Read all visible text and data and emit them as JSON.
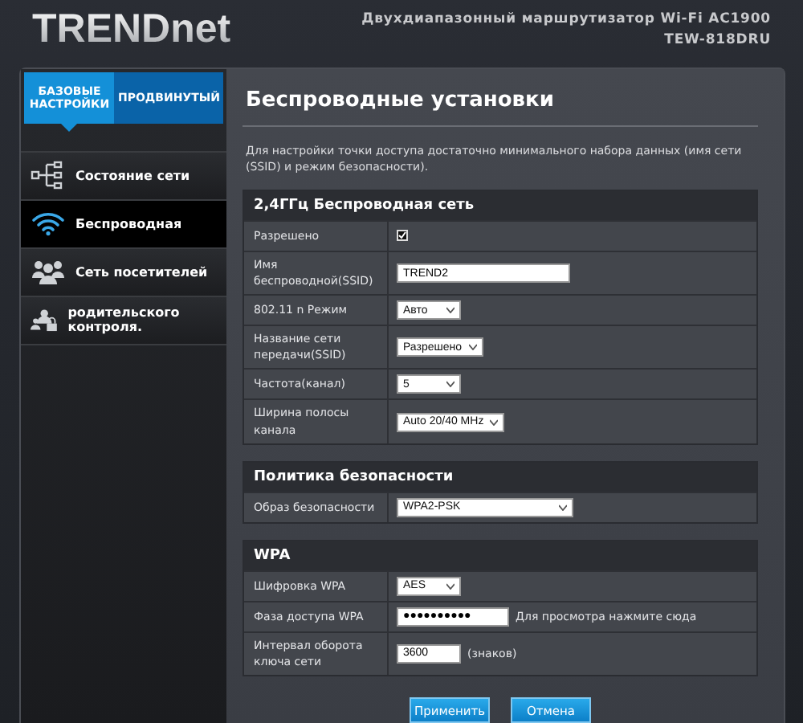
{
  "header": {
    "logo": "TRENDnet",
    "product": "Двухдиапазонный маршрутизатор Wi-Fi AC1900",
    "model": "TEW-818DRU"
  },
  "tabs": [
    {
      "label": "БАЗОВЫЕ НАСТРОЙКИ",
      "selected": true
    },
    {
      "label": "ПРОДВИНУТЫЙ",
      "selected": false
    }
  ],
  "sidebar": {
    "items": [
      {
        "label": "Состояние сети",
        "selected": false
      },
      {
        "label": "Беспроводная",
        "selected": true
      },
      {
        "label": "Сеть посетителей",
        "selected": false
      },
      {
        "label": "родительского контроля.",
        "selected": false
      }
    ]
  },
  "page": {
    "title": "Беспроводные установки",
    "description": "Для настройки точки доступа достаточно минимального набора данных (имя сети (SSID) и режим безопасности)."
  },
  "sections": [
    {
      "title": "2,4ГГц Беспроводная сеть",
      "rows": [
        {
          "label": "Разрешено",
          "kind": "checkbox",
          "checked": true
        },
        {
          "label": "Имя беспроводной(SSID)",
          "kind": "text",
          "value": "TREND2"
        },
        {
          "label": "802.11 n Режим",
          "kind": "select",
          "value": "Авто"
        },
        {
          "label": "Название сети передачи(SSID)",
          "kind": "select",
          "value": "Разрешено"
        },
        {
          "label": "Частота(канал)",
          "kind": "select",
          "value": "5"
        },
        {
          "label": "Ширина полосы канала",
          "kind": "select",
          "value": "Auto 20/40 MHz"
        }
      ]
    },
    {
      "title": "Политика безопасности",
      "rows": [
        {
          "label": "Образ безопасности",
          "kind": "wideselect",
          "value": "WPA2-PSK"
        }
      ]
    },
    {
      "title": "WPA",
      "rows": [
        {
          "label": "Шифровка WPA",
          "kind": "select",
          "value": "AES"
        },
        {
          "label": "Фаза доступа WPA",
          "kind": "password",
          "value": "●●●●●●●●●●",
          "note": "Для просмотра нажмите сюда"
        },
        {
          "label": "Интервал оборота ключа сети",
          "kind": "short",
          "value": "3600",
          "note": "(знаков)"
        }
      ]
    }
  ],
  "buttons": [
    "Применить",
    "Отмена"
  ]
}
